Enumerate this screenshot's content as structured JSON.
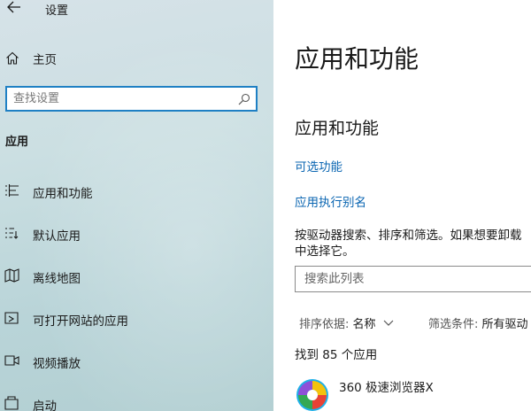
{
  "window": {
    "title": "设置"
  },
  "sidebar": {
    "home_label": "主页",
    "search_placeholder": "查找设置",
    "section_title": "应用",
    "items": [
      {
        "label": "应用和功能",
        "icon": "list-icon"
      },
      {
        "label": "默认应用",
        "icon": "default-apps-icon"
      },
      {
        "label": "离线地图",
        "icon": "map-icon"
      },
      {
        "label": "可打开网站的应用",
        "icon": "web-apps-icon"
      },
      {
        "label": "视频播放",
        "icon": "video-icon"
      },
      {
        "label": "启动",
        "icon": "startup-icon"
      }
    ]
  },
  "main": {
    "page_title": "应用和功能",
    "section_title": "应用和功能",
    "links": [
      "可选功能",
      "应用执行别名"
    ],
    "description_lines": [
      "按驱动器搜索、排序和筛选。如果想要卸载",
      "中选择它。"
    ],
    "list_search_placeholder": "搜索此列表",
    "sort": {
      "key": "排序依据:",
      "value": "名称"
    },
    "filter": {
      "key": "筛选条件:",
      "value": "所有驱动"
    },
    "count_text": "找到 85 个应用",
    "apps": [
      {
        "name": "360 极速浏览器X",
        "icon": "app-360-browser-icon"
      }
    ]
  },
  "colors": {
    "accent": "#1f80c4",
    "link": "#0b66b2"
  }
}
